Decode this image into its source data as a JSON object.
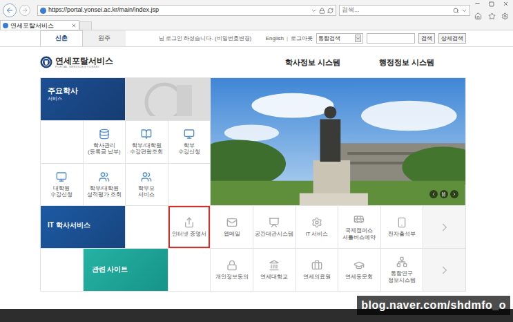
{
  "browser": {
    "address": "https://portal.yonsei.ac.kr/main/index.jsp",
    "search_placeholder": "검색...",
    "tabs": [
      {
        "label": "연세포탈서비스",
        "selected": true
      }
    ]
  },
  "top_bar": {
    "campus_tabs": [
      {
        "label": "신촌",
        "selected": true
      },
      {
        "label": "원주",
        "selected": false
      }
    ],
    "login_message": "님 로그인 하셨습니다. (비밀번호변경)",
    "links": [
      "English",
      "로그아웃"
    ],
    "separator": "|",
    "search_scope": "통합검색",
    "search_value": "",
    "buttons": [
      "검색",
      "상세검색"
    ]
  },
  "header": {
    "logo_title": "연세포탈서비스",
    "logo_subtitle": "PORTAL SERVICE@YONSEI",
    "nav": [
      "학사정보 시스템",
      "행정정보 시스템"
    ]
  },
  "sections": {
    "main": {
      "title": "주요학사",
      "subtitle": "서비스"
    },
    "it": {
      "title": "IT 학사서비스"
    },
    "related": {
      "title": "관련 사이트"
    }
  },
  "main_services": [
    {
      "lines": [
        "학사관리",
        "(등록금 납부)"
      ]
    },
    {
      "lines": [
        "학부/대학원",
        "수강편람조회"
      ]
    },
    {
      "lines": [
        "학부",
        "수강신청"
      ]
    },
    {
      "lines": [
        "대학원",
        "수강신청"
      ]
    },
    {
      "lines": [
        "학부/대학원",
        "성적평가 조회"
      ]
    },
    {
      "lines": [
        "학부모",
        "서비스"
      ]
    }
  ],
  "it_services": [
    {
      "lines": [
        "인터넷 증명서"
      ],
      "selected": true
    },
    {
      "lines": [
        "웹메일"
      ],
      "selected": false
    },
    {
      "lines": [
        "공간대관시스템"
      ],
      "selected": false
    },
    {
      "lines": [
        "IT 서비스"
      ],
      "selected": false
    },
    {
      "lines": [
        "국제캠퍼스",
        "셔틀버스예약"
      ],
      "selected": false
    },
    {
      "lines": [
        "전자출석부"
      ],
      "selected": false
    }
  ],
  "related_sites": [
    {
      "lines": [
        "개인정보동의"
      ]
    },
    {
      "lines": [
        "연세대학교"
      ]
    },
    {
      "lines": [
        "연세의료원"
      ]
    },
    {
      "lines": [
        "연세동문회"
      ]
    },
    {
      "lines": [
        "통합연구",
        "정보시스템"
      ]
    }
  ],
  "carousel": {
    "playing": true
  },
  "watermark": "blog.naver.com/shdmfo_o"
}
